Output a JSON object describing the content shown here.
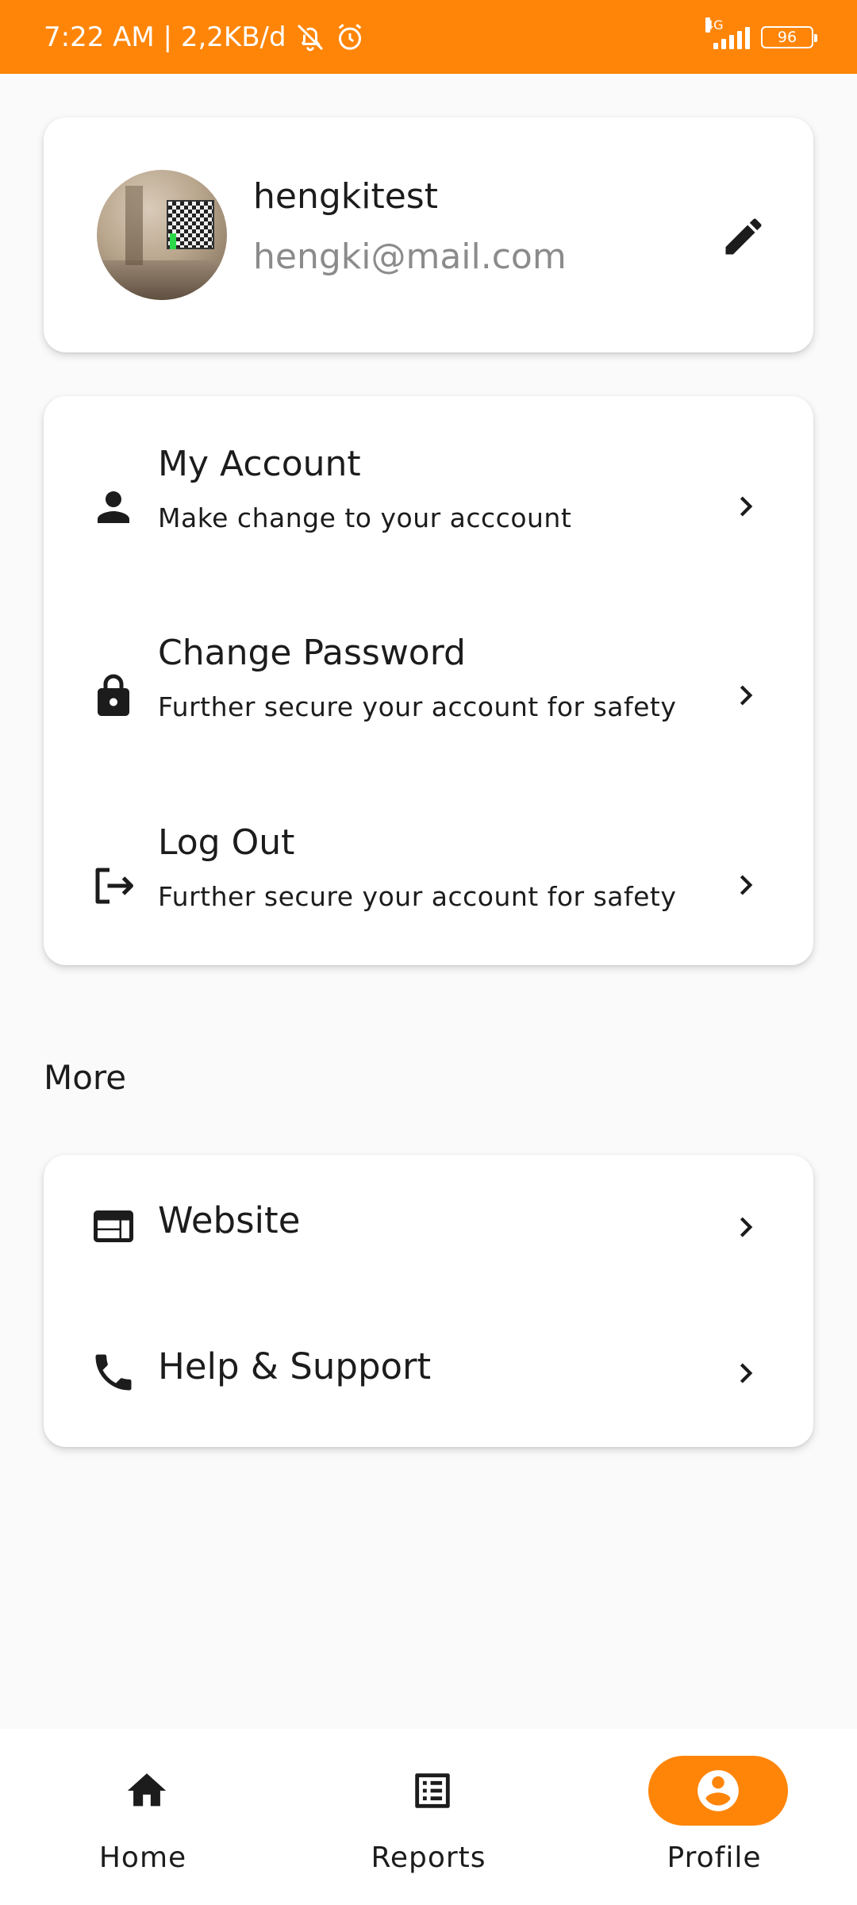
{
  "status_bar": {
    "time_and_speed": "7:22 AM | 2,2KB/d",
    "network_type": "4G",
    "battery_level": "96"
  },
  "profile": {
    "username": "hengkitest",
    "email": "hengki@mail.com",
    "edit_icon": "pencil-icon"
  },
  "account_menu": {
    "items": [
      {
        "title": "My Account",
        "subtitle": "Make change to your acccount",
        "icon": "person-icon"
      },
      {
        "title": "Change Password",
        "subtitle": "Further secure your account for safety",
        "icon": "lock-icon"
      },
      {
        "title": "Log Out",
        "subtitle": "Further secure your account for safety",
        "icon": "logout-icon"
      }
    ]
  },
  "more_section": {
    "heading": "More",
    "items": [
      {
        "title": "Website",
        "icon": "web-icon"
      },
      {
        "title": "Help & Support",
        "icon": "phone-icon"
      }
    ]
  },
  "bottom_nav": {
    "items": [
      {
        "label": "Home",
        "icon": "home-icon",
        "active": false
      },
      {
        "label": "Reports",
        "icon": "list-icon",
        "active": false
      },
      {
        "label": "Profile",
        "icon": "account-circle-icon",
        "active": true
      }
    ]
  },
  "colors": {
    "accent": "#ff8508",
    "background": "#fafafa",
    "card": "#ffffff",
    "text": "#1c1c1c",
    "secondary_text": "#8b8b8b"
  }
}
